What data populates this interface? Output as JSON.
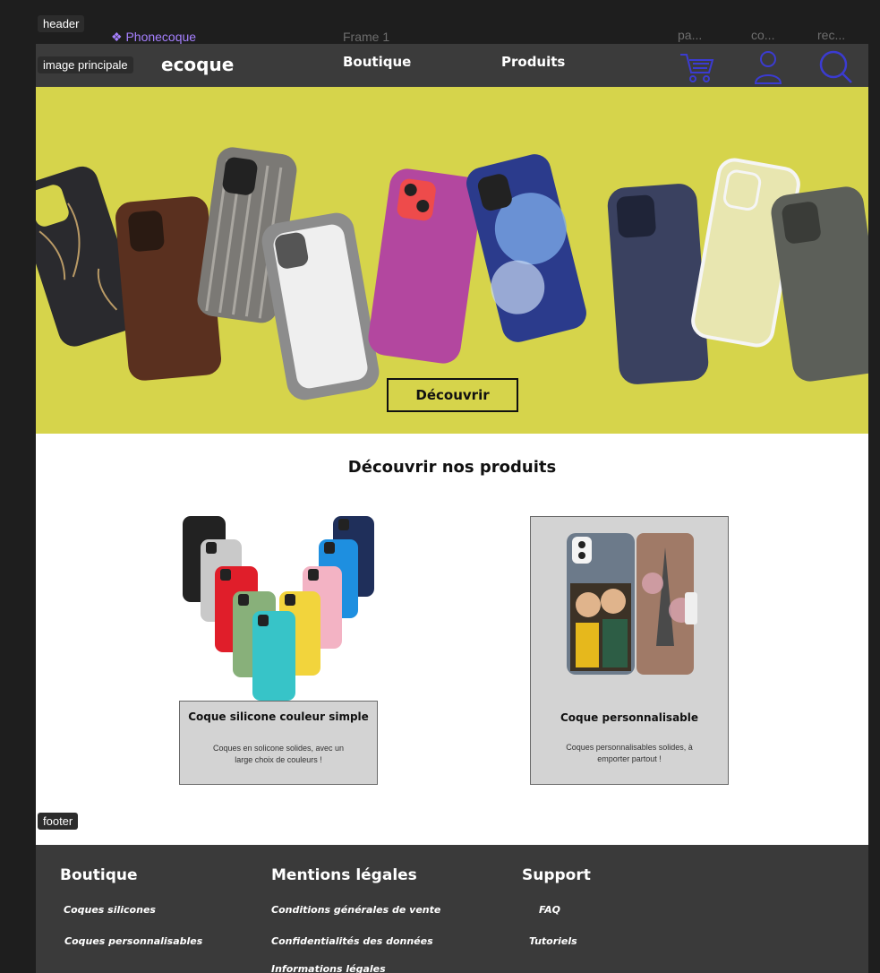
{
  "figma": {
    "tag_header": "header",
    "tag_hero": "image principale",
    "tag_footer": "footer",
    "component_name": "❖ Phonecoque",
    "frame_name": "Frame 1",
    "icon_labels": [
      "pa...",
      "co...",
      "rec..."
    ]
  },
  "header": {
    "logo_suffix": "ecoque",
    "nav": [
      "Boutique",
      "Produits"
    ],
    "icons": [
      "cart-icon",
      "user-icon",
      "search-icon"
    ]
  },
  "hero": {
    "button": "Découvrir",
    "background": "#d6d44b"
  },
  "products": {
    "title": "Découvrir nos produits",
    "cards": [
      {
        "title": "Coque silicone couleur simple",
        "desc": "Coques en solicone solides, avec un large choix de  couleurs !"
      },
      {
        "title": "Coque personnalisable",
        "desc": "Coques personnalisables solides, à emporter partout !"
      }
    ]
  },
  "footer": {
    "columns": [
      {
        "title": "Boutique",
        "links": [
          "Coques silicones",
          "Coques personnalisables"
        ]
      },
      {
        "title": "Mentions légales",
        "links": [
          "Conditions générales de vente",
          "Confidentialités des données",
          "Informations légales"
        ]
      },
      {
        "title": "Support",
        "links": [
          "FAQ",
          "Tutoriels"
        ]
      }
    ]
  },
  "colors": {
    "accent_icon": "#3b3bd1",
    "header_bg": "#3b3b3b",
    "footer_bg": "#3a3a3a"
  }
}
